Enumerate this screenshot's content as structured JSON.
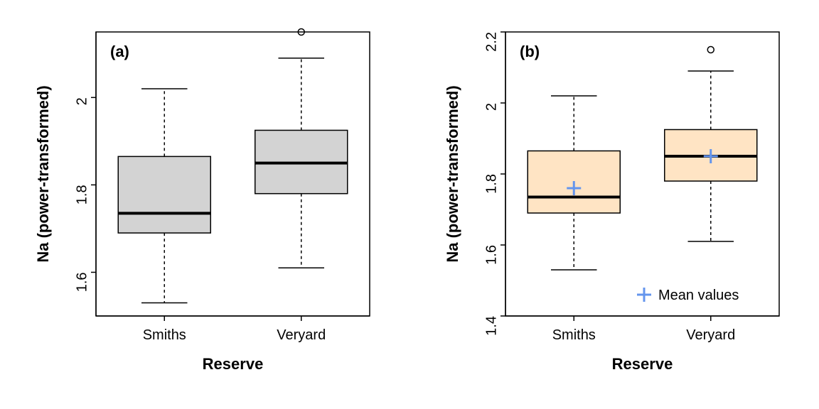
{
  "chart_data": [
    {
      "type": "boxplot",
      "panel_label": "(a)",
      "xlabel": "Reserve",
      "ylabel": "Na (power-transformed)",
      "ylim": [
        1.5,
        2.15
      ],
      "yticks": [
        1.6,
        1.8,
        2.0
      ],
      "categories": [
        "Smiths",
        "Veryard"
      ],
      "fill": "#d3d3d3",
      "series": [
        {
          "name": "Smiths",
          "min": 1.53,
          "q1": 1.69,
          "median": 1.735,
          "q3": 1.865,
          "max": 2.02,
          "outliers": []
        },
        {
          "name": "Veryard",
          "min": 1.61,
          "q1": 1.78,
          "median": 1.85,
          "q3": 1.925,
          "max": 2.09,
          "outliers": [
            2.15
          ]
        }
      ]
    },
    {
      "type": "boxplot",
      "panel_label": "(b)",
      "xlabel": "Reserve",
      "ylabel": "Na (power-transformed)",
      "ylim": [
        1.4,
        2.2
      ],
      "yticks": [
        1.4,
        1.6,
        1.8,
        2.0,
        2.2
      ],
      "categories": [
        "Smiths",
        "Veryard"
      ],
      "fill": "#ffe4c4",
      "legend": {
        "symbol": "+",
        "label": "Mean values",
        "color": "#6495ED"
      },
      "series": [
        {
          "name": "Smiths",
          "min": 1.53,
          "q1": 1.69,
          "median": 1.735,
          "q3": 1.865,
          "max": 2.02,
          "outliers": [],
          "mean": 1.76
        },
        {
          "name": "Veryard",
          "min": 1.61,
          "q1": 1.78,
          "median": 1.85,
          "q3": 1.925,
          "max": 2.09,
          "outliers": [
            2.15
          ],
          "mean": 1.85
        }
      ]
    }
  ]
}
